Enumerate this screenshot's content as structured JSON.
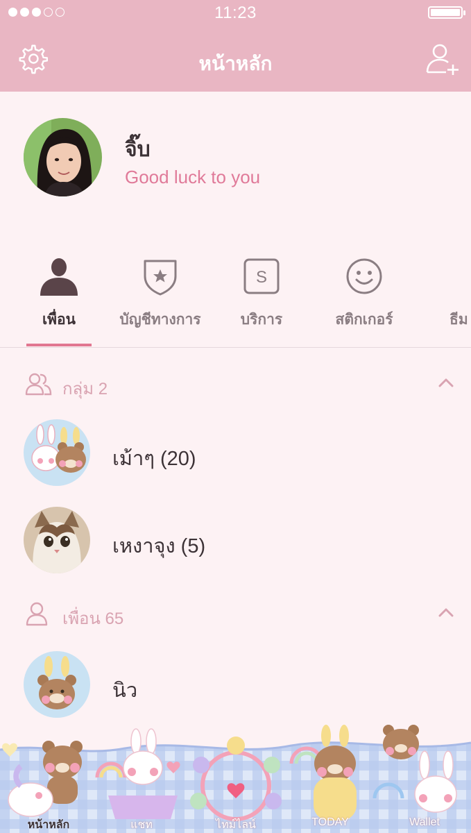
{
  "status_bar": {
    "time": "11:23",
    "signal_bars": 5,
    "signal_filled": 3
  },
  "header": {
    "title": "หน้าหลัก",
    "left_icon": "gear-icon",
    "right_icon": "add-friend-icon"
  },
  "profile": {
    "name": "จิ๊บ",
    "status_message": "Good luck to you"
  },
  "tabs": [
    {
      "label": "เพื่อน",
      "icon": "person-icon",
      "active": true
    },
    {
      "label": "บัญชีทางการ",
      "icon": "official-shield-icon"
    },
    {
      "label": "บริการ",
      "icon": "service-s-icon"
    },
    {
      "label": "สติกเกอร์",
      "icon": "smiley-icon"
    },
    {
      "label": "ธีม",
      "icon": "theme-brush-icon"
    }
  ],
  "groups_section": {
    "label": "กลุ่ม 2",
    "items": [
      {
        "name": "เม้าๆ (20)",
        "avatar": "bunny-bear-avatar"
      },
      {
        "name": "เหงาจุง (5)",
        "avatar": "cat-avatar"
      }
    ]
  },
  "friends_section": {
    "label": "เพื่อน 65",
    "items": [
      {
        "name": "นิว",
        "avatar": "bear-bunny-ears-avatar"
      }
    ]
  },
  "bottom_nav": [
    {
      "label": "หน้าหลัก",
      "active": true
    },
    {
      "label": "แชท"
    },
    {
      "label": "ไทม์ไลน์"
    },
    {
      "label": "TODAY"
    },
    {
      "label": "Wallet"
    }
  ],
  "colors": {
    "header": "#e9b6c3",
    "background": "#fdf2f4",
    "accent": "#e17791",
    "status_text": "#e07a99"
  }
}
